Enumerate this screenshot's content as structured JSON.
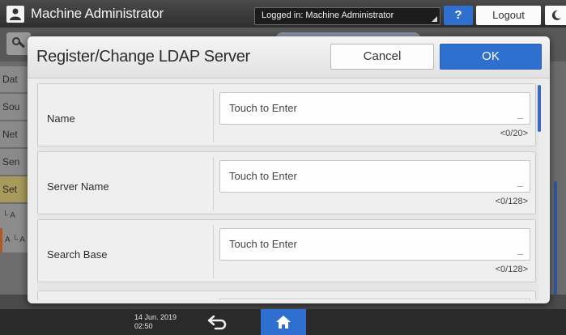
{
  "topbar": {
    "user_title": "Machine Administrator",
    "login_status": "Logged in: Machine Administrator",
    "help_label": "?",
    "logout_label": "Logout"
  },
  "background": {
    "sidebar_items": [
      "Dat",
      "Sou",
      "Net",
      "Sen",
      "Set"
    ],
    "sidebar_subitems": [
      "└ A",
      "A └ A"
    ]
  },
  "dialog": {
    "title": "Register/Change LDAP Server",
    "cancel_label": "Cancel",
    "ok_label": "OK",
    "fields": [
      {
        "label": "Name",
        "placeholder": "Touch to Enter",
        "count": "<0/20>"
      },
      {
        "label": "Server Name",
        "placeholder": "Touch to Enter",
        "count": "<0/128>"
      },
      {
        "label": "Search Base",
        "placeholder": "Touch to Enter",
        "count": "<0/128>"
      }
    ]
  },
  "bottombar": {
    "date": "14 Jun. 2019",
    "time": "02:50"
  },
  "colors": {
    "accent_blue": "#2f6fd0",
    "dialog_bg": "#ececec",
    "topbar_bg": "#2e2e2e"
  },
  "icons": [
    "user-icon",
    "help-icon",
    "energy-saver-icon",
    "tools-icon",
    "back-arrow-icon",
    "home-icon"
  ]
}
